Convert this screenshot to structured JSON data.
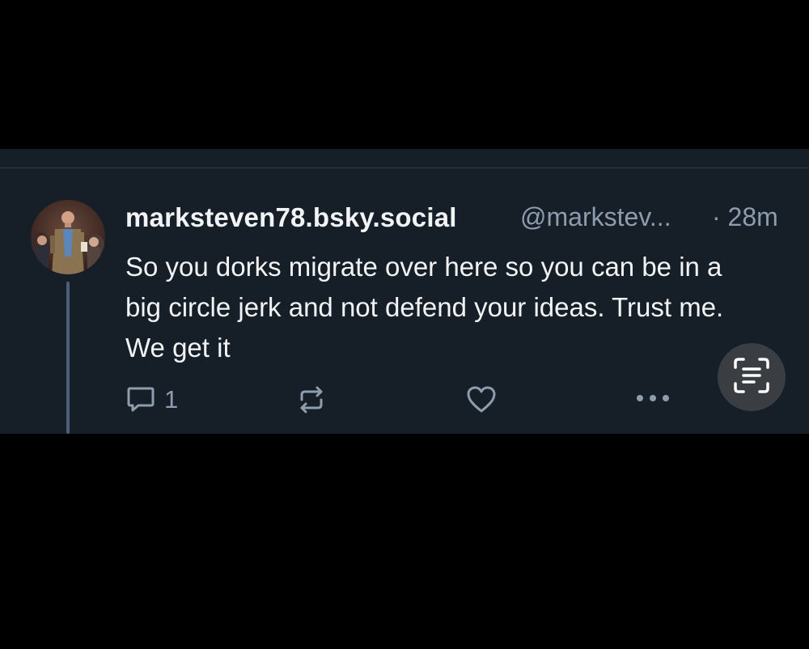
{
  "post": {
    "display_name": "marksteven78.bsky.social",
    "handle": "@markstev...",
    "time": "· 28m",
    "text": "So you dorks migrate over here so you can be in a big circle jerk and not defend your ideas. Trust me. We get it"
  },
  "actions": {
    "reply_count": "1",
    "icons": [
      "reply-icon",
      "repost-icon",
      "like-icon",
      "more-icon",
      "text-scan-icon"
    ]
  },
  "colors": {
    "background": "#000000",
    "card": "#161e27",
    "text_primary": "#f1f3f5",
    "text_secondary": "#8d9cae",
    "thread_line": "#4b6078"
  }
}
